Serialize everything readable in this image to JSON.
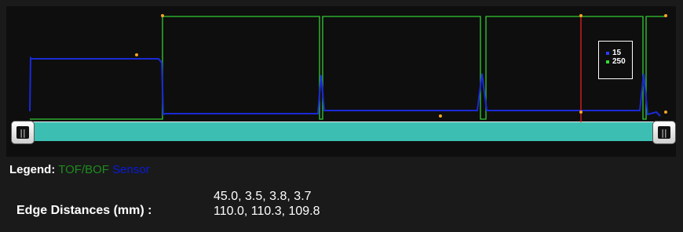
{
  "legend": {
    "title": "Legend:",
    "series": [
      {
        "label": "TOF/BOF",
        "color": "#1e8c1e"
      },
      {
        "label": "Sensor",
        "color": "#0a1ad8"
      }
    ]
  },
  "cursor_legend": {
    "items": [
      {
        "value": "15",
        "color": "#2a3cff"
      },
      {
        "value": "250",
        "color": "#33dd33"
      }
    ]
  },
  "edge_distances": {
    "label": "Edge Distances (mm) :",
    "line1": "45.0, 3.5, 3.8, 3.7",
    "line2": "110.0, 110.3, 109.8"
  },
  "slider": {
    "left_handle_icon": "grip-icon",
    "right_handle_icon": "grip-icon",
    "track_color": "#3cbfb2"
  },
  "colors": {
    "tof": "#33cc33",
    "sensor": "#1a2ad6",
    "cursor": "#ff2020",
    "marker": "#f5a623",
    "background": "#0e0e0e"
  }
}
